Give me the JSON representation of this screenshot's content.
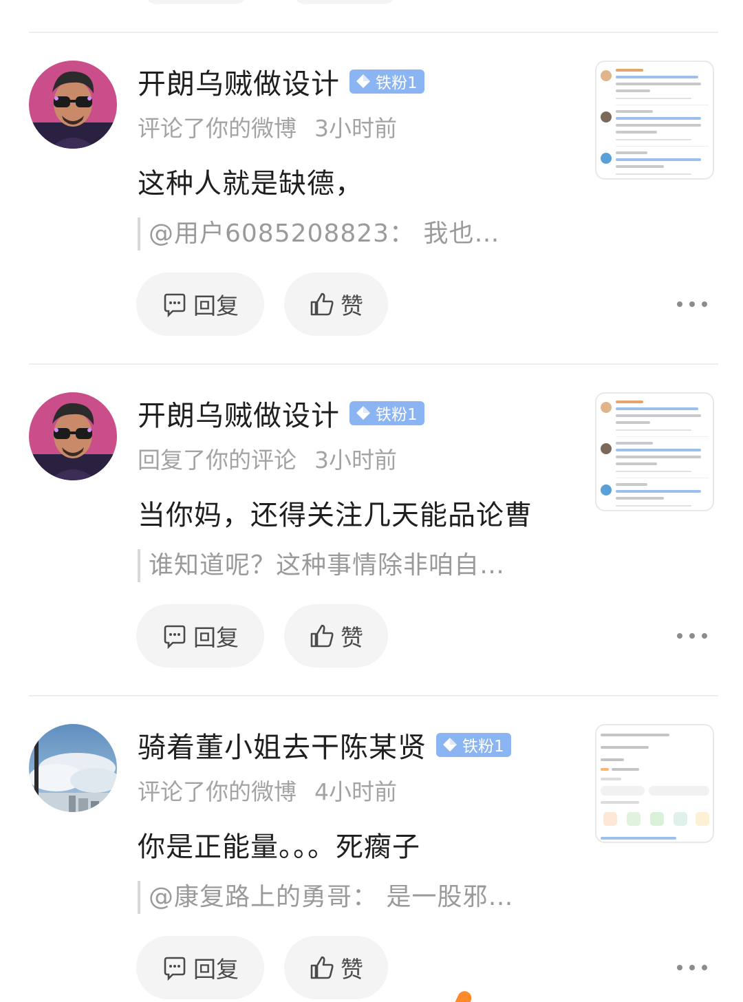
{
  "items": [
    {
      "name": "开朗乌贼做设计",
      "badge": "铁粉1",
      "action": "评论了你的微博",
      "time": "3小时前",
      "content": "这种人就是缺德，",
      "quote": "@用户6085208823： 我也…",
      "reply_label": "回复",
      "like_label": "赞",
      "avatar": "man-sunglasses-avatar",
      "thumbnail": "comment-thread-screenshot"
    },
    {
      "name": "开朗乌贼做设计",
      "badge": "铁粉1",
      "action": "回复了你的评论",
      "time": "3小时前",
      "content": "当你妈，还得关注几天能品论曹",
      "quote": "谁知道呢？这种事情除非咱自…",
      "reply_label": "回复",
      "like_label": "赞",
      "avatar": "man-sunglasses-avatar",
      "thumbnail": "comment-thread-screenshot"
    },
    {
      "name": "骑着董小姐去干陈某贤",
      "badge": "铁粉1",
      "action": "评论了你的微博",
      "time": "4小时前",
      "content": "你是正能量。。。死瘸子",
      "quote": "@康复路上的勇哥： 是一股邪…",
      "reply_label": "回复",
      "like_label": "赞",
      "avatar": "sky-clouds-avatar",
      "thumbnail": "weibo-post-screenshot"
    }
  ],
  "colors": {
    "badge_bg": "#8ab4f2",
    "pill_bg": "#f4f4f4",
    "meta_text": "#a3a3a3",
    "quote_text": "#9a9a9a",
    "divider": "#ececec"
  },
  "icons": {
    "reply": "comment-bubble-icon",
    "like": "thumbs-up-icon",
    "more": "more-dots-icon",
    "badge": "diamond-icon"
  }
}
